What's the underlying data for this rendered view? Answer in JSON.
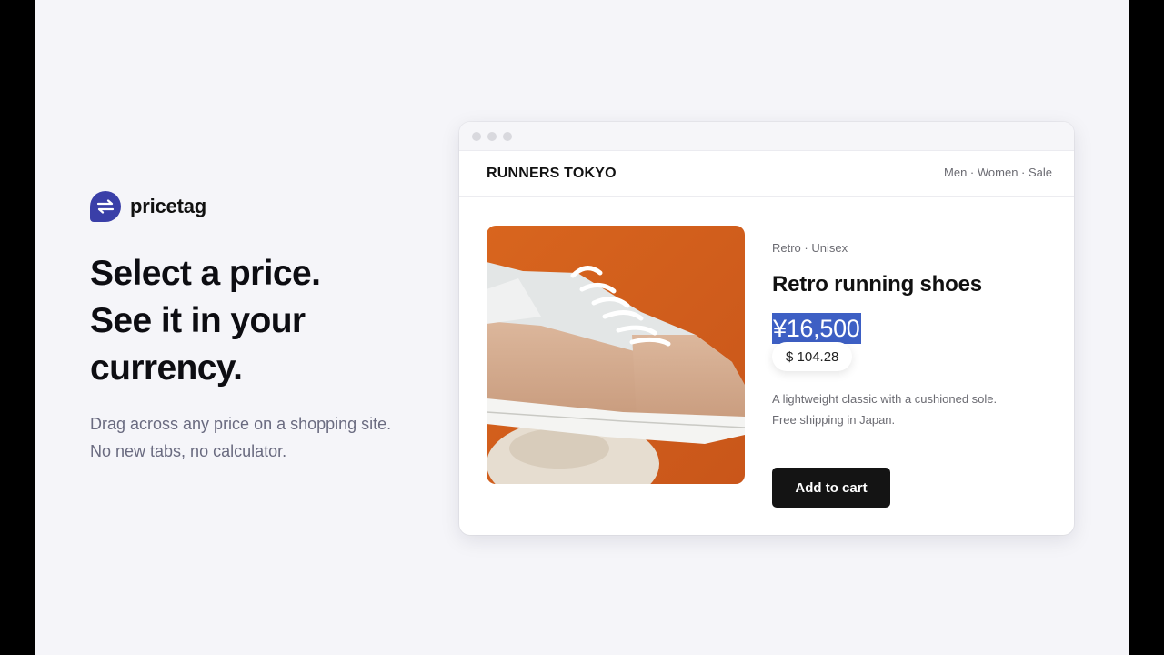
{
  "brand": {
    "name": "pricetag",
    "logo_icon": "exchange-arrows-icon",
    "color": "#3a3fa8"
  },
  "hero": {
    "headline": [
      "Select a price.",
      "See it in your",
      "currency."
    ],
    "subtext": [
      "Drag across any price on a shopping site.",
      "No new tabs, no calculator."
    ]
  },
  "browser": {
    "shop_name": "RUNNERS TOKYO",
    "nav_links": "Men · Women · Sale",
    "product": {
      "meta": "Retro · Unisex",
      "title": "Retro running shoes",
      "price": "¥16,500",
      "converted_price": "$ 104.28",
      "description": [
        "A lightweight classic with a cushioned sole.",
        "Free shipping in Japan."
      ],
      "cta": "Add to cart",
      "image_icon": "sneaker-photo"
    }
  },
  "colors": {
    "highlight": "#3d5fc4",
    "background": "#f5f5f9",
    "button": "#141414"
  }
}
